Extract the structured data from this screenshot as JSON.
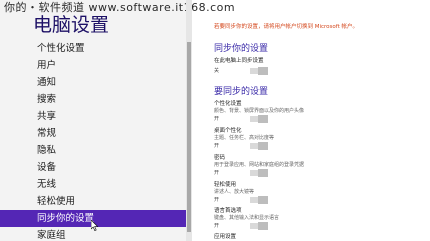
{
  "watermark": "你的・软件频道 www.software.it168.com",
  "app": {
    "title": "电脑设置"
  },
  "sidebar": {
    "items": [
      {
        "label": "个性化设置"
      },
      {
        "label": "用户"
      },
      {
        "label": "通知"
      },
      {
        "label": "搜索"
      },
      {
        "label": "共享"
      },
      {
        "label": "常规"
      },
      {
        "label": "隐私"
      },
      {
        "label": "设备"
      },
      {
        "label": "无线"
      },
      {
        "label": "轻松使用"
      },
      {
        "label": "同步你的设置",
        "selected": true
      },
      {
        "label": "家庭组"
      }
    ]
  },
  "main": {
    "notice": "若要同步你的设置，请将用户帐户切换到 Microsoft 帐户。",
    "sync_section": {
      "title": "同步你的设置",
      "label": "在此电脑上同步设置",
      "state": "关"
    },
    "settings_section": {
      "title": "要同步的设置",
      "items": [
        {
          "label": "个性化设置",
          "desc": "颜色、背景、锁屏界面以及你的用户头像",
          "state": "开"
        },
        {
          "label": "桌面个性化",
          "desc": "主题、任务栏、高对比度等",
          "state": "开"
        },
        {
          "label": "密码",
          "desc": "用于登录应用、网站和家庭组的登录凭据",
          "state": "开"
        },
        {
          "label": "轻松使用",
          "desc": "讲述人、放大镜等",
          "state": "开"
        },
        {
          "label": "语言首选项",
          "desc": "键盘、其他输入法和显示语言",
          "state": "开"
        },
        {
          "label": "应用设置",
          "desc": "",
          "state": ""
        }
      ]
    }
  },
  "colors": {
    "accent": "#5426b5",
    "title": "#1d1066",
    "notice": "#d4471c",
    "section_header": "#3a2aa8"
  }
}
